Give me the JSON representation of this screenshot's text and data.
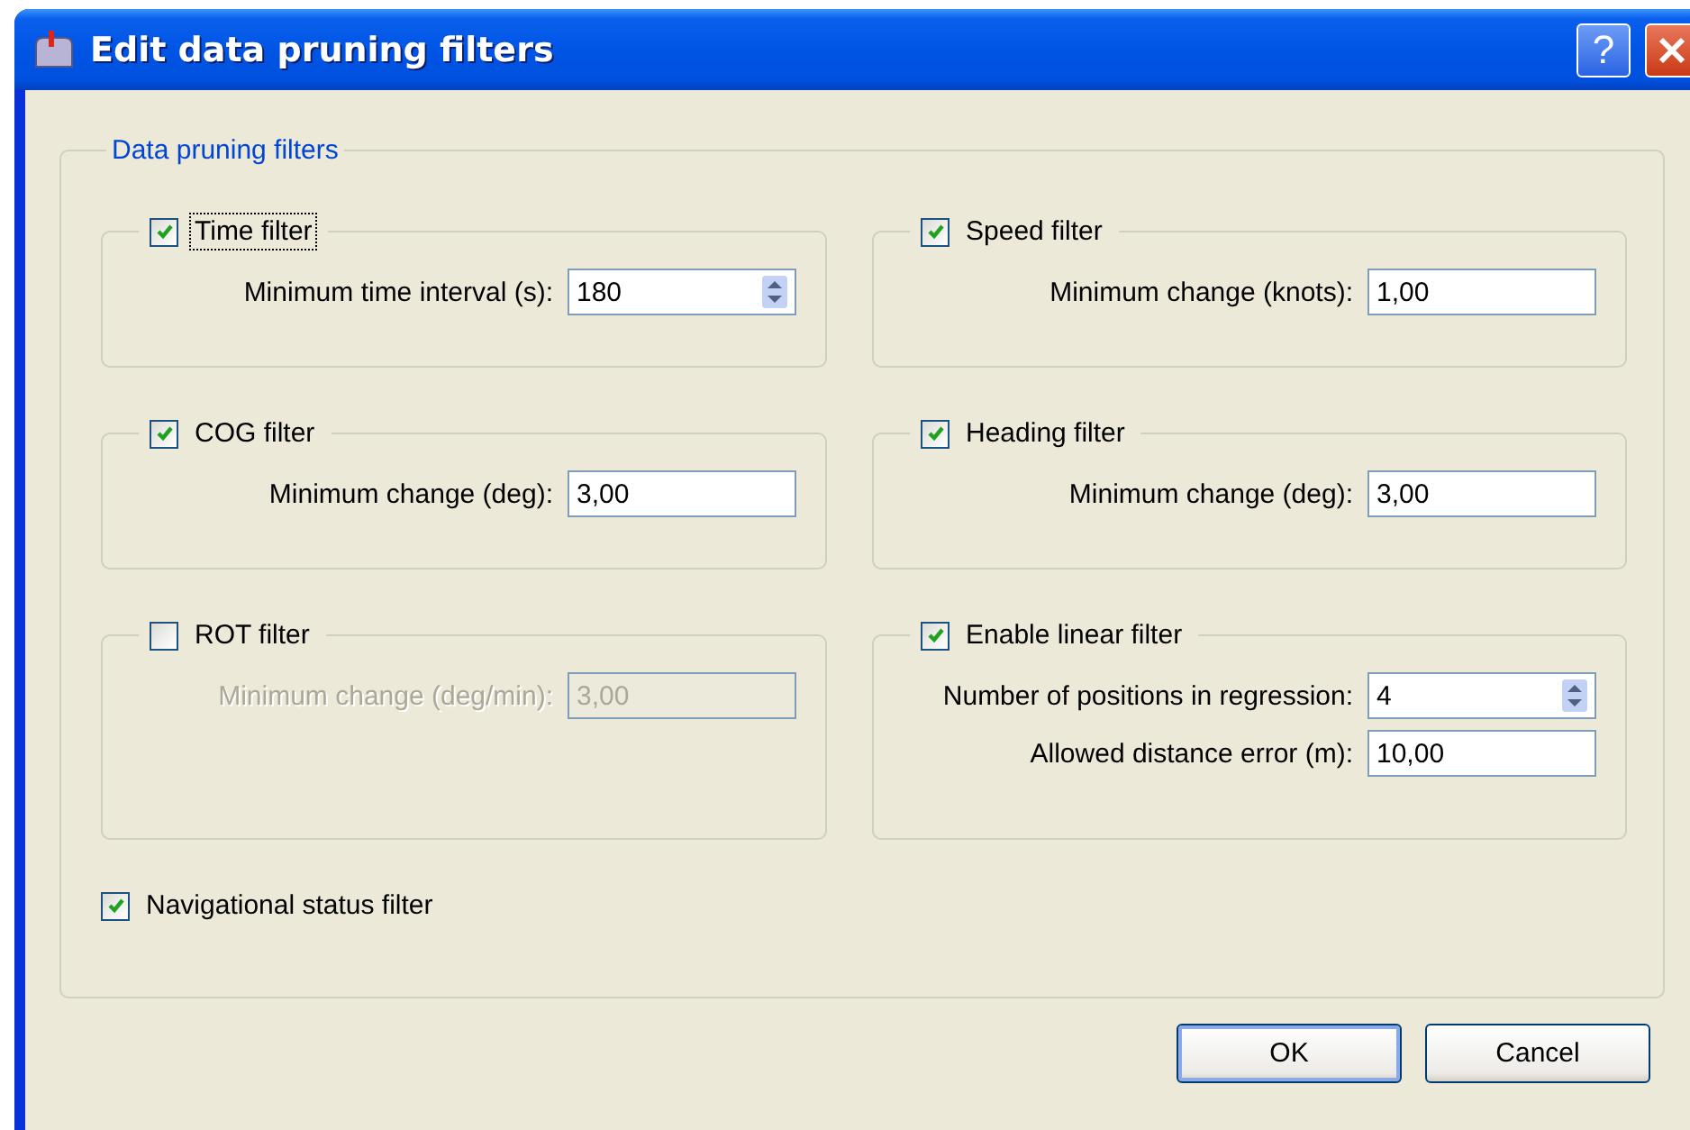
{
  "window": {
    "title": "Edit data pruning filters",
    "help_button": "?"
  },
  "group": {
    "title": "Data pruning filters"
  },
  "filters": [
    {
      "title": "Time filter",
      "checked": true,
      "focused": true,
      "fields": [
        {
          "label": "Minimum time interval (s):",
          "value": "180",
          "kind": "spin"
        }
      ]
    },
    {
      "title": "Speed filter",
      "checked": true,
      "focused": false,
      "fields": [
        {
          "label": "Minimum change (knots):",
          "value": "1,00",
          "kind": "text"
        }
      ]
    },
    {
      "title": "COG filter",
      "checked": true,
      "focused": false,
      "fields": [
        {
          "label": "Minimum change (deg):",
          "value": "3,00",
          "kind": "text"
        }
      ]
    },
    {
      "title": "Heading filter",
      "checked": true,
      "focused": false,
      "fields": [
        {
          "label": "Minimum change (deg):",
          "value": "3,00",
          "kind": "text"
        }
      ]
    },
    {
      "title": "ROT filter",
      "checked": false,
      "focused": false,
      "fields": [
        {
          "label": "Minimum change (deg/min):",
          "value": "3,00",
          "kind": "text"
        }
      ]
    },
    {
      "title": "Enable linear filter",
      "checked": true,
      "focused": false,
      "fields": [
        {
          "label": "Number of positions in regression:",
          "value": "4",
          "kind": "spin"
        },
        {
          "label": "Allowed distance error (m):",
          "value": "10,00",
          "kind": "text"
        }
      ]
    }
  ],
  "nav_status": {
    "label": "Navigational status filter",
    "checked": true
  },
  "buttons": [
    {
      "label": "OK",
      "default": true
    },
    {
      "label": "Cancel",
      "default": false
    }
  ]
}
